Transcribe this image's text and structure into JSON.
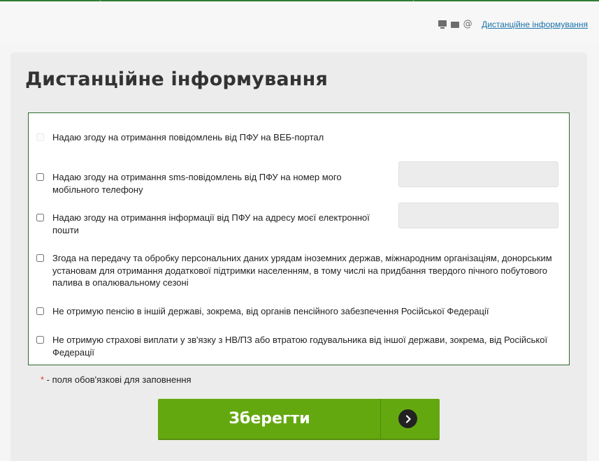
{
  "header": {
    "link_label": "Дистанційне інформування",
    "icons": [
      "monitor-icon",
      "mail-icon",
      "at-icon"
    ],
    "at_glyph": "@"
  },
  "page": {
    "title": "Дистанційне інформування"
  },
  "options": [
    {
      "label": "Надаю згоду на отримання повідомлень від ПФУ на ВЕБ-портал",
      "checked": false,
      "disabled": true
    },
    {
      "label": "Надаю згоду на отримання sms-повідомлень від ПФУ на номер мого мобільного телефону",
      "checked": false,
      "disabled": false,
      "input_value": ""
    },
    {
      "label": "Надаю згоду на отримання інформації від ПФУ на адресу моєї електронної пошти",
      "checked": false,
      "disabled": false,
      "input_value": ""
    },
    {
      "label": "Згода на передачу та обробку персональних даних урядам іноземних держав, міжнародним організаціям, донорським установам для отримання додаткової підтримки населенням, в тому числі на придбання твердого пічного побутового палива в опалювальному сезоні",
      "checked": false,
      "disabled": false
    },
    {
      "label": "Не отримую пенсію в іншій державі, зокрема, від органів пенсійного забезпечення Російської Федерації",
      "checked": false,
      "disabled": false
    },
    {
      "label": "Не отримую страхові виплати у зв'язку з НВ/ПЗ або втратою годувальника від іншої держави, зокрема, від Російської Федерації",
      "checked": false,
      "disabled": false
    }
  ],
  "required_note": {
    "star": "*",
    "text": " - поля обов'язкові для заповнення"
  },
  "save_button": {
    "label": "Зберегти"
  },
  "colors": {
    "accent_green": "#64a810",
    "border_green": "#2d6a2d",
    "link_blue": "#1a73a8",
    "required_red": "#e53935"
  }
}
